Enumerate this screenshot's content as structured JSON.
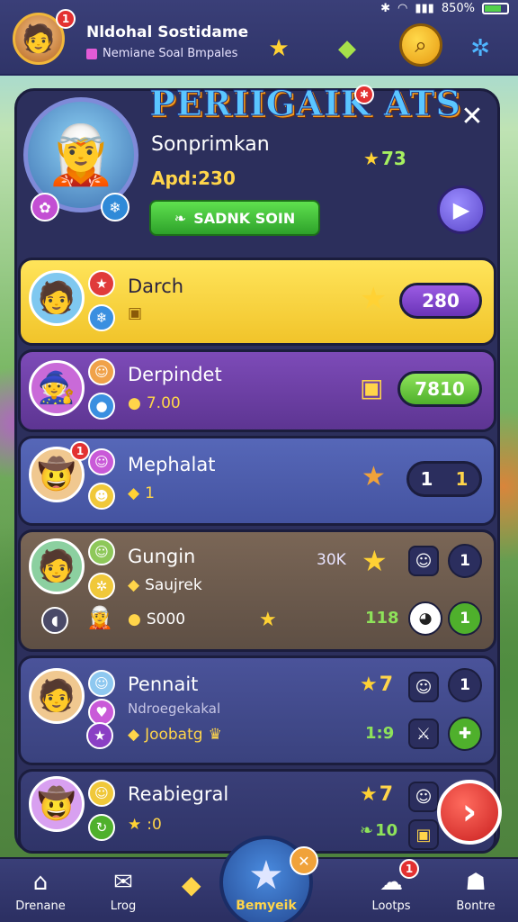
{
  "status": {
    "bluetooth": "✱",
    "wifi": "◠",
    "signal": "▮▮▮",
    "battery_text": "850%"
  },
  "header": {
    "title": "Nldohal Sostidame",
    "subtitle": "Nemiane Soal Bmpales",
    "avatar_badge": "1"
  },
  "profile": {
    "game_title": "PERIIGAIK ATS",
    "player_name": "Sonprimkan",
    "score_label": "Apd:230",
    "stars": "73",
    "action_label": "SADNK SOIN"
  },
  "rows": [
    {
      "name": "Darch",
      "score": "280",
      "color": "#f6d13a",
      "pill_color": "#7a3fc4"
    },
    {
      "name": "Derpindet",
      "sub_value": "7.00",
      "score": "7810",
      "color": "#6e3fa6",
      "pill_color": "#62c83e"
    },
    {
      "name": "Mephalat",
      "sub_value": "1",
      "score_left": "1",
      "score_right": "1",
      "color": "#4a5aa6"
    },
    {
      "name": "Gungin",
      "sub_label": "Saujrek",
      "sub_value": "S000",
      "rank_text": "30K",
      "side_value": "118",
      "counter": "1",
      "green_value": "1",
      "color": "#6b5a4e"
    },
    {
      "name": "Pennait",
      "sub_label": "Ndroegekakal",
      "sub_value": "Joobatg",
      "stars": "7",
      "side_value": "1:9",
      "counter": "1",
      "color": "#3d4585"
    },
    {
      "name": "Reabiegral",
      "sub_value": ":0",
      "stars": "7",
      "side_value": "10",
      "color": "#2f3468"
    }
  ],
  "nav": {
    "items": [
      "Drenane",
      "Lrog",
      "Bemyeik",
      "Lootps",
      "Bontre"
    ],
    "fab_badge": "✕",
    "lootps_badge": "1"
  }
}
